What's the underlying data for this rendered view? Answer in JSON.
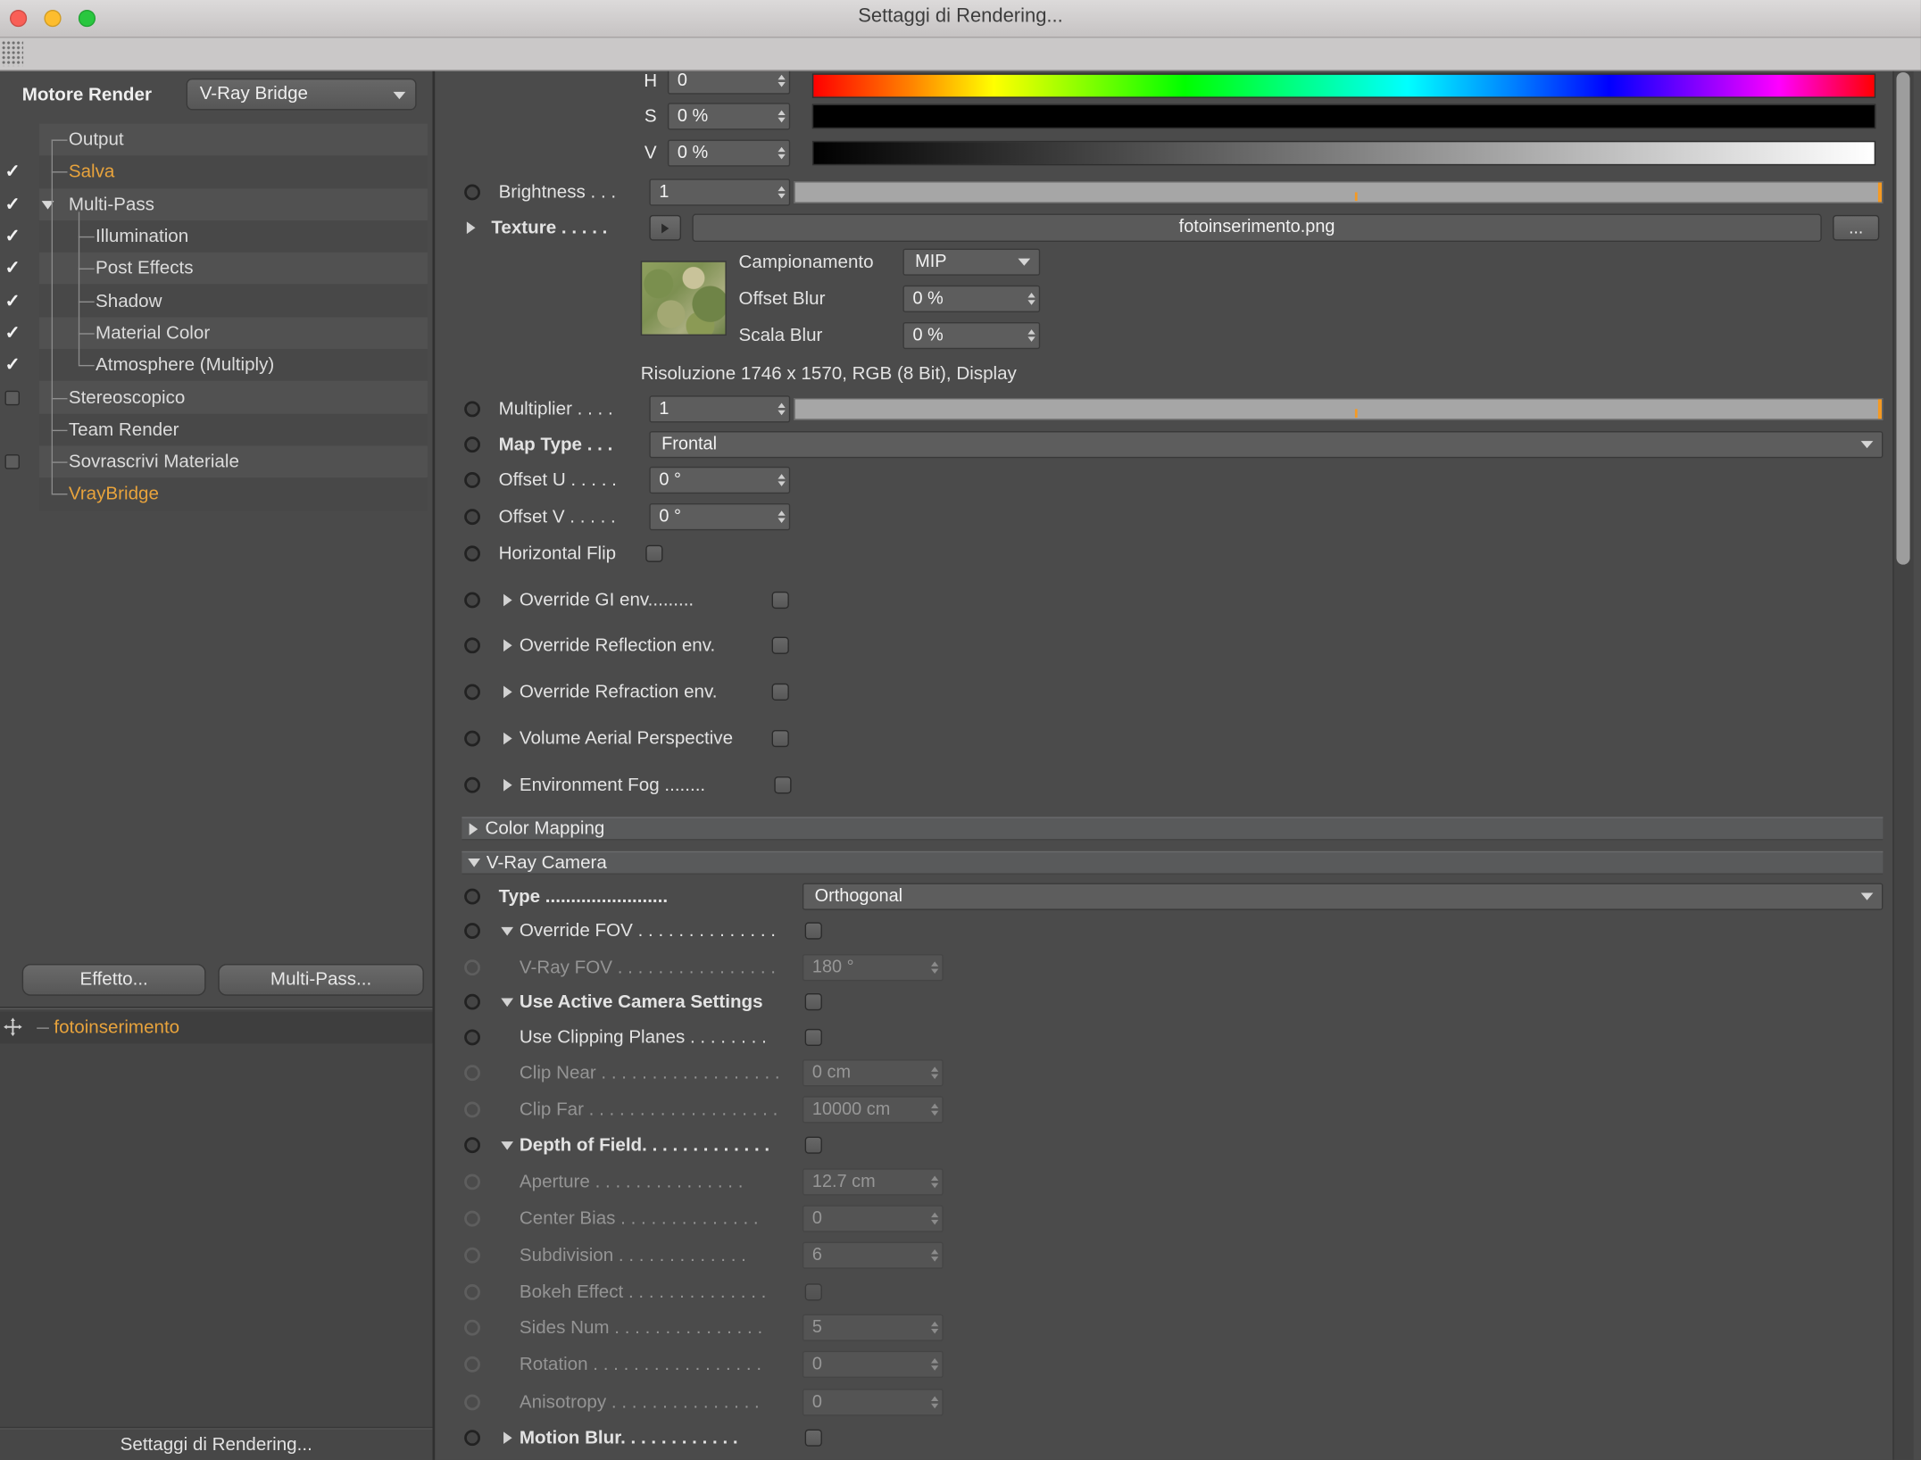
{
  "window": {
    "title": "Settaggi di Rendering...",
    "footer": "Settaggi di Rendering..."
  },
  "left_panel": {
    "engine_label": "Motore Render",
    "engine_value": "V-Ray Bridge",
    "tree": [
      {
        "label": "Output"
      },
      {
        "label": "Salva"
      },
      {
        "label": "Multi-Pass"
      },
      {
        "label": "Illumination"
      },
      {
        "label": "Post Effects"
      },
      {
        "label": "Shadow"
      },
      {
        "label": "Material Color"
      },
      {
        "label": "Atmosphere (Multiply)"
      },
      {
        "label": "Stereoscopico"
      },
      {
        "label": "Team Render"
      },
      {
        "label": "Sovrascrivi Materiale"
      },
      {
        "label": "VrayBridge"
      }
    ],
    "effect_button": "Effetto...",
    "multipass_button": "Multi-Pass...",
    "material_item": "fotoinserimento"
  },
  "color_picker": {
    "h_label": "H",
    "h_value": "0",
    "s_label": "S",
    "s_value": "0 %",
    "v_label": "V",
    "v_value": "0 %"
  },
  "texture_section": {
    "brightness_label": "Brightness . . .",
    "brightness_value": "1",
    "texture_label": "Texture . . . . .",
    "texture_file": "fotoinserimento.png",
    "browse_label": "...",
    "sampling_label": "Campionamento",
    "sampling_value": "MIP",
    "offset_blur_label": "Offset Blur",
    "offset_blur_value": "0 %",
    "scale_blur_label": "Scala Blur",
    "scale_blur_value": "0 %",
    "resolution_text": "Risoluzione 1746 x 1570, RGB (8 Bit), Display",
    "multiplier_label": "Multiplier . . . .",
    "multiplier_value": "1",
    "map_type_label": "Map Type . . .",
    "map_type_value": "Frontal",
    "offset_u_label": "Offset U . . . . .",
    "offset_u_value": "0 °",
    "offset_v_label": "Offset V . . . . .",
    "offset_v_value": "0 °",
    "horizontal_flip_label": "Horizontal Flip"
  },
  "environment": {
    "override_gi": "Override GI env.........",
    "override_reflection": "Override Reflection env.",
    "override_refraction": "Override Refraction env.",
    "volume_aerial": "Volume Aerial Perspective",
    "environment_fog": "Environment Fog ........"
  },
  "sections": {
    "color_mapping": "Color Mapping",
    "vray_camera": "V-Ray Camera"
  },
  "camera": {
    "type_label": "Type ........................",
    "type_value": "Orthogonal",
    "override_fov_label": "Override FOV . . . . . . . . . . . . . .",
    "vray_fov_label": "V-Ray FOV . . . . . . . . . . . . . . . .",
    "vray_fov_value": "180 °",
    "use_active_label": "Use Active Camera Settings",
    "use_clipping_label": "Use Clipping Planes . . . . . . . .",
    "clip_near_label": "Clip Near . . . . . . . . . . . . . . . . . .",
    "clip_near_value": "0 cm",
    "clip_far_label": "Clip Far . . . . . . . . . . . . . . . . . . .",
    "clip_far_value": "10000 cm",
    "dof_label": "Depth of Field. . . . . . . . . . . . .",
    "aperture_label": "Aperture . . . . . . . . . . . . . . .",
    "aperture_value": "12.7 cm",
    "center_bias_label": "Center Bias . . . . . . . . . . . . . .",
    "center_bias_value": "0",
    "subdivision_label": "Subdivision . . . . . . . . . . . . .",
    "subdivision_value": "6",
    "bokeh_label": "Bokeh Effect . . . . . . . . . . . . . .",
    "sides_label": "Sides Num . . . . . . . . . . . . . . .",
    "sides_value": "5",
    "rotation_label": "Rotation . . . . . . . . . . . . . . . . .",
    "rotation_value": "0",
    "anisotropy_label": "Anisotropy . . . . . . . . . . . . . . .",
    "anisotropy_value": "0",
    "motion_blur_label": "Motion Blur. . . . . . . . . . . ."
  },
  "colors": {
    "accent_orange": "#e8a33c",
    "panel_background": "#4b4b4b"
  }
}
